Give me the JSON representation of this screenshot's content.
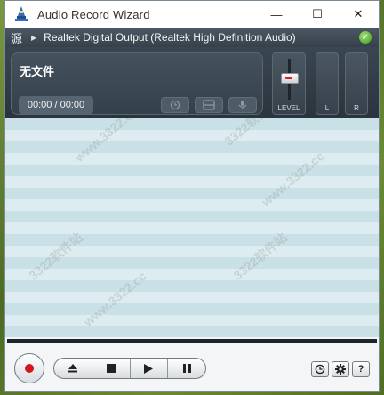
{
  "window": {
    "title": "Audio Record Wizard",
    "minimize_glyph": "—",
    "maximize_glyph": "☐",
    "close_glyph": "✕"
  },
  "source": {
    "label": "源",
    "device": "Realtek Digital Output (Realtek High Definition Audio)",
    "status_icon": "green-check-icon"
  },
  "display": {
    "file_name": "无文件",
    "time": "00:00 / 00:00",
    "buttons": [
      "schedule-icon",
      "window-icon",
      "mic-settings-icon"
    ]
  },
  "meters": {
    "level_label": "LEVEL",
    "left_label": "L",
    "right_label": "R",
    "level_value": 0.6
  },
  "list": {
    "rows": 19,
    "watermarks": [
      "www.3322.cc",
      "3322软件站",
      "www.3322.cc",
      "3322软件站",
      "www.3322.cc",
      "3322软件站"
    ]
  },
  "controls": {
    "record": "record-icon",
    "transport": [
      "eject-icon",
      "stop-icon",
      "play-icon",
      "pause-icon"
    ],
    "right": [
      "clock-icon",
      "gear-icon",
      "help-icon"
    ],
    "help_label": "?"
  },
  "colors": {
    "record_red": "#d2141c",
    "header_dark": "#2a343d",
    "list_row_a": "#c9e0e7",
    "list_row_b": "#ddecf0",
    "status_green": "#3f9b1e"
  }
}
